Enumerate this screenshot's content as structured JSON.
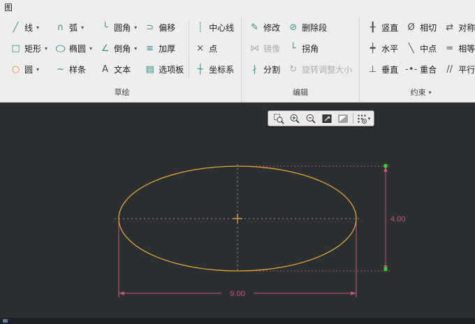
{
  "window": {
    "tab": "图"
  },
  "ui": {
    "caret": "▾"
  },
  "ribbon": {
    "groups": [
      {
        "label": "草绘",
        "columns": [
          {
            "buttons": [
              {
                "label": "线",
                "icon": "line-icon",
                "glyph": "╱",
                "dropdown": true
              },
              {
                "label": "矩形",
                "icon": "rectangle-icon",
                "glyph": "□",
                "dropdown": true
              },
              {
                "label": "圆",
                "icon": "circle-icon",
                "glyph": "○",
                "dropdown": true
              }
            ]
          },
          {
            "buttons": [
              {
                "label": "弧",
                "icon": "arc-icon",
                "glyph": "∩",
                "dropdown": true
              },
              {
                "label": "椭圆",
                "icon": "ellipse-icon",
                "glyph": "○",
                "dropdown": true
              },
              {
                "label": "样条",
                "icon": "spline-icon",
                "glyph": "~"
              }
            ]
          },
          {
            "buttons": [
              {
                "label": "圆角",
                "icon": "fillet-icon",
                "glyph": "╰",
                "dropdown": true
              },
              {
                "label": "倒角",
                "icon": "chamfer-icon",
                "glyph": "∠",
                "dropdown": true
              },
              {
                "label": "文本",
                "icon": "text-icon",
                "glyph": "A"
              }
            ]
          },
          {
            "buttons": [
              {
                "label": "偏移",
                "icon": "offset-icon",
                "glyph": "⊃"
              },
              {
                "label": "加厚",
                "icon": "thicken-icon",
                "glyph": "≡"
              },
              {
                "label": "选项板",
                "icon": "palette-icon",
                "glyph": "▤"
              }
            ]
          },
          {
            "buttons": [
              {
                "label": "中心线",
                "icon": "centerline-icon",
                "glyph": "┊"
              },
              {
                "label": "点",
                "icon": "point-icon",
                "glyph": "×"
              },
              {
                "label": "坐标系",
                "icon": "csys-icon",
                "glyph": "┼"
              }
            ]
          }
        ]
      },
      {
        "label": "编辑",
        "columns": [
          {
            "buttons": [
              {
                "label": "修改",
                "icon": "modify-icon",
                "glyph": "✎"
              },
              {
                "label": "镜像",
                "icon": "mirror-icon",
                "glyph": "⋈",
                "disabled": true
              },
              {
                "label": "分割",
                "icon": "divide-icon",
                "glyph": "∤"
              }
            ]
          },
          {
            "buttons": [
              {
                "label": "删除段",
                "icon": "delete-segment-icon",
                "glyph": "⊘"
              },
              {
                "label": "拐角",
                "icon": "corner-icon",
                "glyph": "└"
              },
              {
                "label": "旋转调整大小",
                "icon": "rotate-resize-icon",
                "glyph": "↻",
                "disabled": true
              }
            ]
          }
        ]
      },
      {
        "label": "约束",
        "label_dropdown": true,
        "columns": [
          {
            "buttons": [
              {
                "label": "竖直",
                "icon": "vertical-constraint-icon",
                "glyph": "╂"
              },
              {
                "label": "水平",
                "icon": "horizontal-constraint-icon",
                "glyph": "┿"
              },
              {
                "label": "垂直",
                "icon": "perpendicular-constraint-icon",
                "glyph": "⊥"
              }
            ]
          },
          {
            "buttons": [
              {
                "label": "相切",
                "icon": "tangent-constraint-icon",
                "glyph": "Ø"
              },
              {
                "label": "中点",
                "icon": "midpoint-constraint-icon",
                "glyph": "╲"
              },
              {
                "label": "重合",
                "icon": "coincident-constraint-icon",
                "glyph": "-•-"
              }
            ]
          },
          {
            "buttons": [
              {
                "label": "对称",
                "icon": "symmetric-constraint-icon",
                "glyph": "⇄"
              },
              {
                "label": "相等",
                "icon": "equal-constraint-icon",
                "glyph": "="
              },
              {
                "label": "平行",
                "icon": "parallel-constraint-icon",
                "glyph": "//"
              }
            ]
          }
        ]
      }
    ]
  },
  "canvas": {
    "toolbar": [
      "zoom-window",
      "zoom-in",
      "zoom-out",
      "refit",
      "display-style",
      "sketcher-display"
    ],
    "dimensions": {
      "height": "4.00",
      "width": "9.00"
    },
    "colors": {
      "entity": "#e8a33d",
      "centerline": "#a07cc0",
      "dimension": "#c25a6e",
      "handle": "#35d435",
      "background": "#2c2f31"
    }
  }
}
